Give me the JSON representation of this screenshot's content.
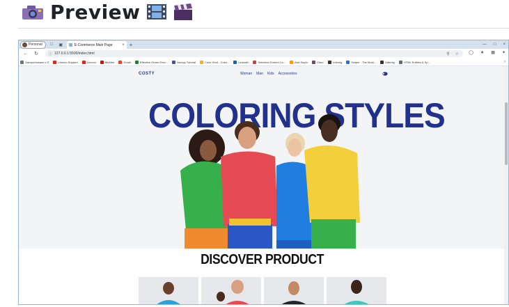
{
  "heading": {
    "title": "Preview"
  },
  "browser": {
    "profile_label": "Personal",
    "tab_title": "E-Commerce Main Page",
    "url": "127.0.0.1:5500/index.html",
    "bookmarks": [
      {
        "label": "Zaimportowane z E",
        "color": "#6a737d"
      },
      {
        "label": "Lenovo Support",
        "color": "#e2231a"
      },
      {
        "label": "Lenovo",
        "color": "#e2231a"
      },
      {
        "label": "McAfee",
        "color": "#c01818"
      },
      {
        "label": "Gmail",
        "color": "#ea4335"
      },
      {
        "label": "Effective Green Ener...",
        "color": "#2e7d32"
      },
      {
        "label": "Numpy Tutorial",
        "color": "#3f51b5"
      },
      {
        "label": "Color Hunt - Color...",
        "color": "#f4b400"
      },
      {
        "label": "LinkedIn",
        "color": "#0a66c2"
      },
      {
        "label": "Selection Embed Co...",
        "color": "#e53935"
      },
      {
        "label": "Ana Sayfa",
        "color": "#ff9800"
      },
      {
        "label": "Odoo",
        "color": "#714b67"
      },
      {
        "label": "Udemig",
        "color": "#333333"
      },
      {
        "label": "Swiper - The Most...",
        "color": "#1976d2"
      },
      {
        "label": "Udemig",
        "color": "#333333"
      },
      {
        "label": "HTML Entities & Sp...",
        "color": "#546e7a"
      }
    ]
  },
  "site": {
    "logo": "COSTY",
    "menu": [
      "Woman",
      "Man",
      "Kids",
      "Accessories"
    ],
    "hero_title": "COLORING STYLES",
    "section_title": "DISCOVER PRODUCT",
    "colors": {
      "brand": "#22318c"
    }
  }
}
